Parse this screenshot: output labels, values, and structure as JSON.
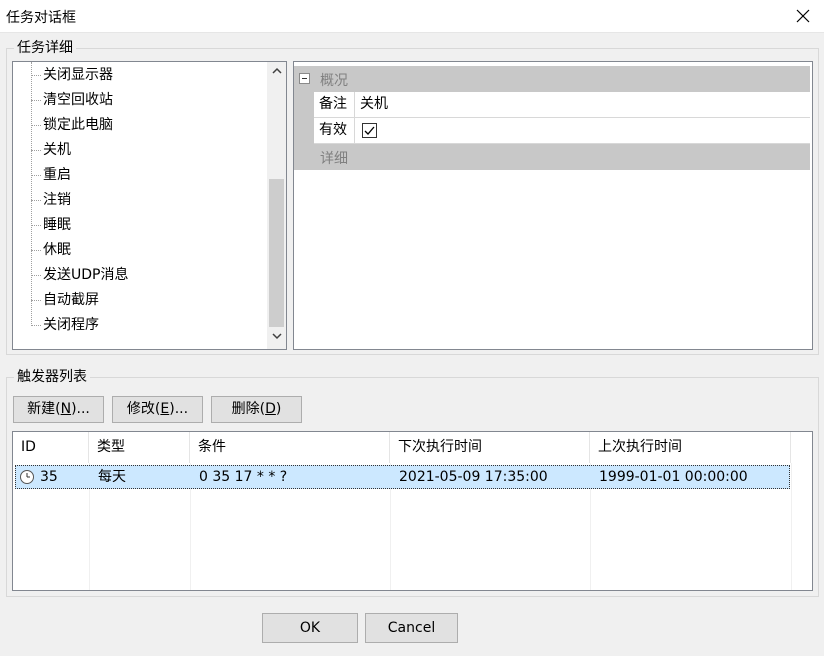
{
  "window": {
    "title": "任务对话框"
  },
  "task_detail": {
    "group_label": "任务详细",
    "tree_items": [
      "关闭显示器",
      "清空回收站",
      "锁定此电脑",
      "关机",
      "重启",
      "注销",
      "睡眠",
      "休眠",
      "发送UDP消息",
      "自动截屏",
      "关闭程序"
    ],
    "selected_item": "关机",
    "property_grid": {
      "category_overview": "概况",
      "note_label": "备注",
      "note_value": "关机",
      "enabled_label": "有效",
      "enabled_checked": true,
      "category_detail": "详细"
    }
  },
  "triggers": {
    "group_label": "触发器列表",
    "new_label": "新建(",
    "new_key": "N",
    "new_suffix": ")...",
    "edit_label": "修改(",
    "edit_key": "E",
    "edit_suffix": ")...",
    "delete_label": "删除(",
    "delete_key": "D",
    "delete_suffix": ")",
    "columns": [
      "ID",
      "类型",
      "条件",
      "下次执行时间",
      "上次执行时间"
    ],
    "rows": [
      {
        "id": "35",
        "type": "每天",
        "condition": "0 35 17 * * ?",
        "next_run": "2021-05-09 17:35:00",
        "last_run": "1999-01-01 00:00:00",
        "icon": "clock-icon"
      }
    ]
  },
  "footer": {
    "ok_label": "OK",
    "cancel_label": "Cancel"
  },
  "colors": {
    "selection": "#cce8ff",
    "button_face": "#e1e1e1",
    "category_band": "#c8c8c8"
  }
}
